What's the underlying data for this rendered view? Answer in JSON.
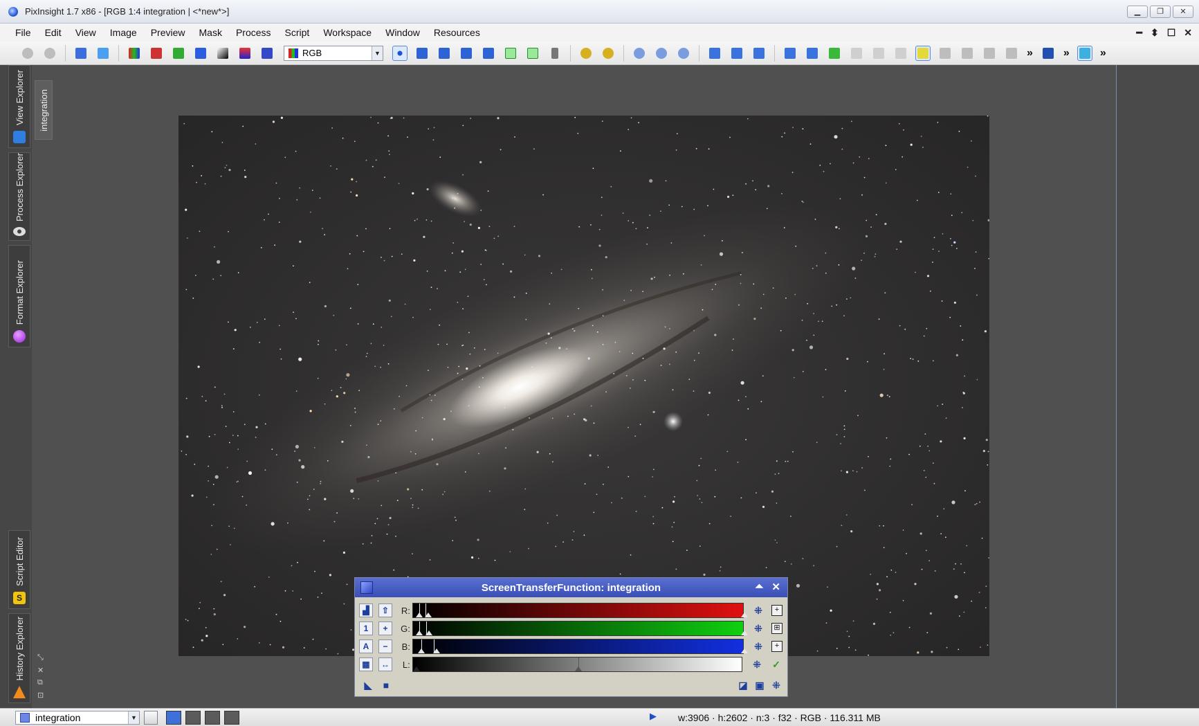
{
  "window": {
    "title": "PixInsight 1.7 x86 - [RGB 1:4 integration | <*new*>]",
    "controls": [
      "minimize",
      "restore",
      "close"
    ]
  },
  "menubar": {
    "items": [
      "File",
      "Edit",
      "View",
      "Image",
      "Preview",
      "Mask",
      "Process",
      "Script",
      "Workspace",
      "Window",
      "Resources"
    ],
    "mdi_controls": [
      "━",
      "⬍",
      "☐",
      "✕"
    ]
  },
  "toolbar": {
    "channel_combo": "RGB",
    "overflow_glyph": "»"
  },
  "sidebar": {
    "tabs": [
      {
        "label": "View Explorer",
        "icon": "view-explorer-icon",
        "color": "#2f7fe0"
      },
      {
        "label": "Process Explorer",
        "icon": "gear-icon",
        "color": "#dddddd"
      },
      {
        "label": "Format Explorer",
        "icon": "sphere-icon",
        "color": "#b23cf0"
      },
      {
        "label": "Script Editor",
        "icon": "script-icon",
        "color": "#f1c40f"
      },
      {
        "label": "History Explorer",
        "icon": "cone-icon",
        "color": "#f28a1e"
      }
    ]
  },
  "view": {
    "tab_label": "integration",
    "image_alt": "Andromeda galaxy star field"
  },
  "stf": {
    "title": "ScreenTransferFunction: integration",
    "channels": [
      {
        "label": "R:",
        "color": "#e01010"
      },
      {
        "label": "G:",
        "color": "#10d010"
      },
      {
        "label": "B:",
        "color": "#1230e0"
      },
      {
        "label": "L:",
        "color": "#ffffff"
      }
    ],
    "left_buttons": [
      [
        "▟",
        "⇧"
      ],
      [
        "1",
        "+"
      ],
      [
        "A",
        "−"
      ],
      [
        "▦",
        "↔"
      ]
    ],
    "right_icons": [
      "⁜",
      "⁜",
      "⁜",
      "⁜"
    ],
    "right_toggles": [
      "+",
      "⊞",
      "+",
      "✓"
    ],
    "bottom_left": [
      "◣",
      "■"
    ],
    "bottom_right": [
      "◪",
      "▣",
      "⁜"
    ]
  },
  "statusbar": {
    "view_selector": "integration",
    "info": "w:3906 · h:2602 · n:3 · f32 · RGB · 116.311 MB"
  }
}
